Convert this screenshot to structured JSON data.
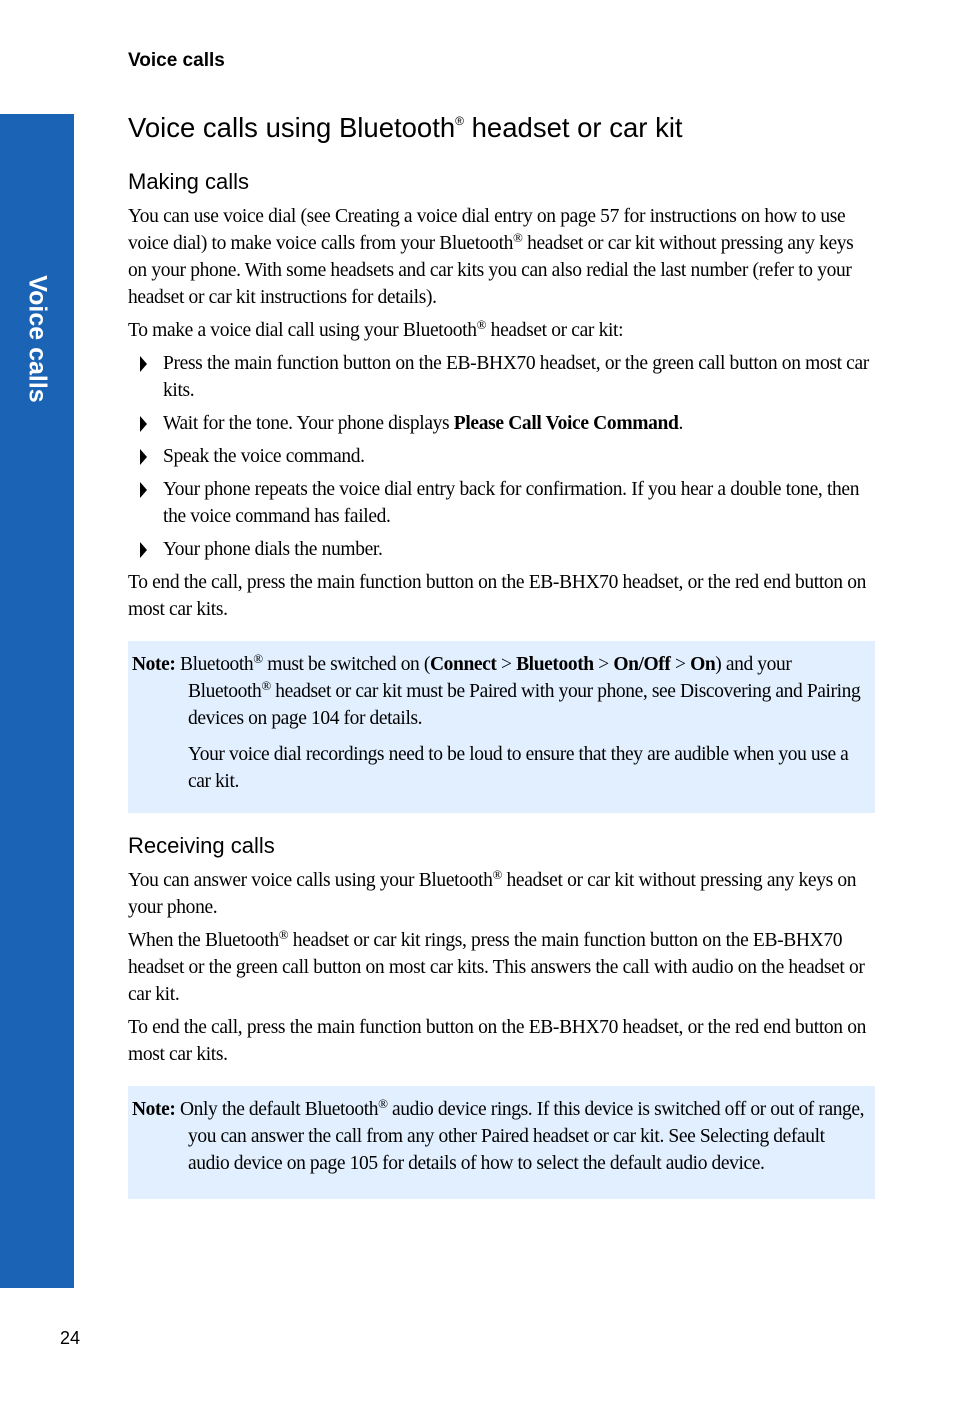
{
  "running_header": "Voice calls",
  "side_tab": {
    "label": "Voice calls",
    "color": "#1b63b5"
  },
  "title": {
    "text": "Voice calls using Bluetooth",
    "reg": "®",
    "text_after": " headset or car kit"
  },
  "reg_mark": "®",
  "making_calls": {
    "heading": "Making calls",
    "intro_p1": "You can use voice dial (see Creating a voice dial entry on page 57 for instructions on how to use voice dial) to make voice calls from your Bluetooth",
    "intro_p1_after": " headset or car kit without pressing any keys on your phone. With some headsets and car kits you can also redial the last number (refer to your headset or car kit instructions for details).",
    "intro_p2": "To make a voice dial call using your Bluetooth",
    "intro_p2_after": " headset or car kit:",
    "steps": [
      {
        "text": "Press the main function button on the EB-BHX70 headset, or the green call button on most car kits."
      },
      {
        "text": "Wait for the tone. Your phone displays ",
        "bold": "Please Call Voice Command",
        "after": "."
      },
      {
        "text": "Speak the voice command."
      },
      {
        "text": "Your phone repeats the voice dial entry back for confirmation. If you hear a double tone, then the voice command has failed."
      },
      {
        "text": "Your phone dials the number."
      }
    ],
    "end_call": "To end the call, press the main function button on the EB-BHX70 headset, or the red end button on most car kits.",
    "note": {
      "label": "Note:",
      "l1_a": " Bluetooth",
      "l1_b": " must be switched on (",
      "path": [
        "Connect",
        "Bluetooth",
        "On/Off",
        "On"
      ],
      "sep": " > ",
      "l1_c": ") and your Bluetooth",
      "l1_d": " headset or car kit must be Paired with your phone, see Discovering and Pairing devices on page 104 for details.",
      "para2": "Your voice dial recordings need to be loud to ensure that they are audible when you use a car kit.",
      "bg": "#e2efff"
    }
  },
  "receiving_calls": {
    "heading": "Receiving calls",
    "p1": "You can answer voice calls using your Bluetooth",
    "p1_after": " headset or car kit without pressing any keys on your phone.",
    "p2": "When the Bluetooth",
    "p2_after": " headset or car kit rings, press the main function button on the EB-BHX70 headset or the green call button on most car kits. This answers the call with audio on the headset or car kit.",
    "p3": "To end the call, press the main function button on the EB-BHX70 headset, or the red end button on most car kits.",
    "note": {
      "label": "Note:",
      "a": " Only the default Bluetooth",
      "b": " audio device rings. If this device is switched off or out of range, you can answer the call from any other Paired headset or car kit. See Selecting default audio device on page 105 for details of how to select the default audio device."
    }
  },
  "page_number": "24"
}
